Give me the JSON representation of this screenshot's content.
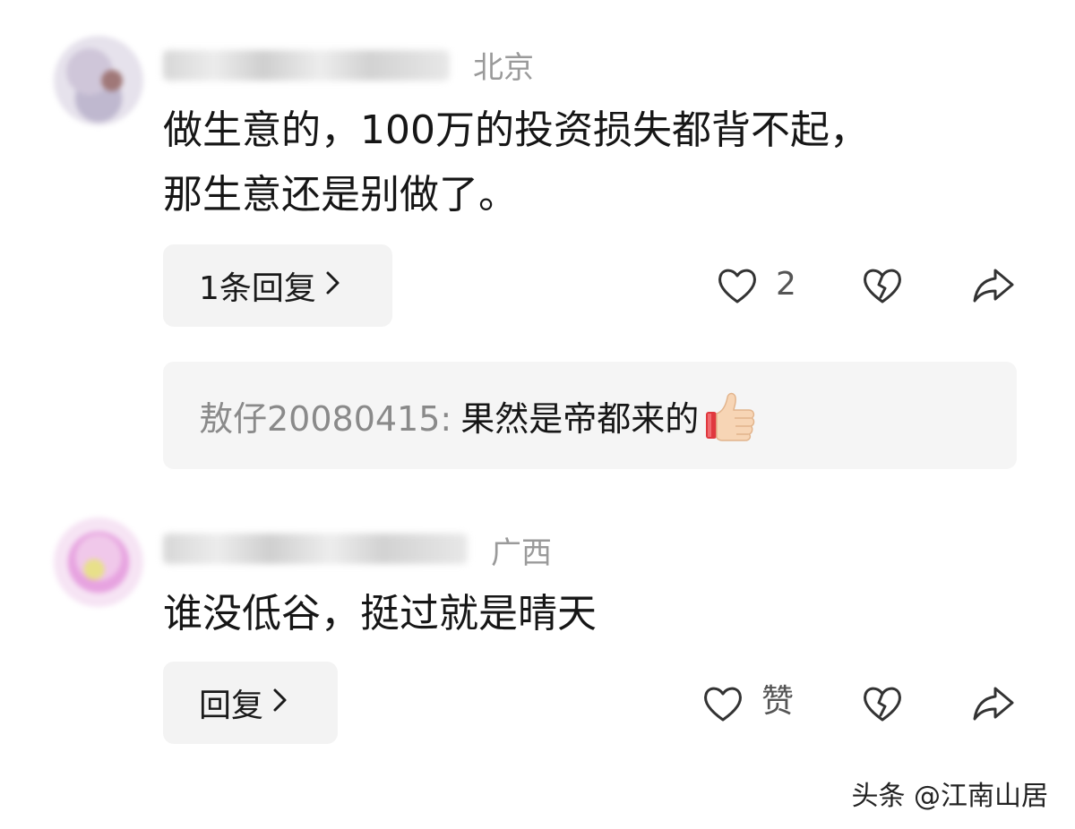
{
  "comments": [
    {
      "location": "北京",
      "text_line1": "做生意的，100万的投资损失都背不起，",
      "text_line2": "那生意还是别做了。",
      "reply_label": "1条回复",
      "like_count": "2",
      "sub_reply": {
        "author": "敖仔20080415:",
        "text": "果然是帝都来的"
      }
    },
    {
      "location": "广西",
      "text": "谁没低谷，挺过就是晴天",
      "reply_label": "回复",
      "like_label": "赞"
    }
  ],
  "icons": {
    "like": "heart-outline-icon",
    "dislike": "broken-heart-icon",
    "share": "share-arrow-icon",
    "chevron": "chevron-right-icon",
    "thumb": "thumbs-up-emoji-icon"
  },
  "watermark": "头条 @江南山居"
}
